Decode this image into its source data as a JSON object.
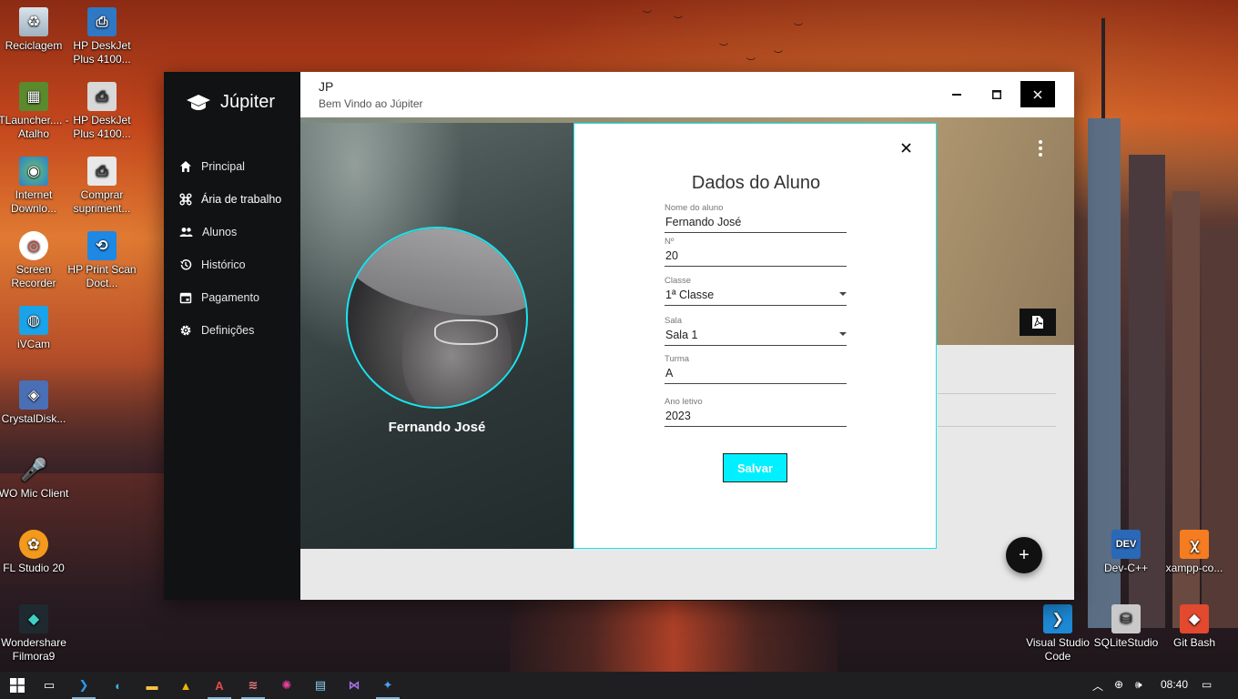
{
  "desktop": {
    "icons_left": [
      {
        "label": "Reciclagem"
      },
      {
        "label": "HP DeskJet Plus 4100..."
      },
      {
        "label": "TLauncher.... - Atalho"
      },
      {
        "label": "HP DeskJet Plus 4100..."
      },
      {
        "label": "Internet Downlo..."
      },
      {
        "label": "Comprar supriment..."
      },
      {
        "label": "Screen Recorder"
      },
      {
        "label": "HP Print Scan Doct..."
      },
      {
        "label": "iVCam"
      },
      {
        "label": "CrystalDisk..."
      },
      {
        "label": "WO Mic Client"
      },
      {
        "label": "FL Studio 20"
      },
      {
        "label": "Wondershare Filmora9"
      }
    ],
    "icons_right": [
      {
        "label": "Dev-C++"
      },
      {
        "label": "xampp-co..."
      },
      {
        "label": "Visual Studio Code"
      },
      {
        "label": "SQLiteStudio"
      },
      {
        "label": "Git Bash"
      }
    ]
  },
  "app": {
    "brand": "Júpiter",
    "nav": [
      {
        "label": "Principal",
        "icon": "home-icon"
      },
      {
        "label": "Ária de trabalho",
        "icon": "command-icon"
      },
      {
        "label": "Alunos",
        "icon": "people-icon"
      },
      {
        "label": "Histórico",
        "icon": "history-icon"
      },
      {
        "label": "Pagamento",
        "icon": "calendar-icon"
      },
      {
        "label": "Definições",
        "icon": "gear-icon"
      }
    ],
    "titlebar": {
      "title": "JP",
      "subtitle": "Bem Vindo ao  Júpiter"
    },
    "fab_label": "+"
  },
  "student": {
    "display_name": "Fernando José"
  },
  "form": {
    "title": "Dados do Aluno",
    "fields": {
      "nome": {
        "label": "Nome do aluno",
        "value": "Fernando José"
      },
      "numero": {
        "label": "Nº",
        "value": "20"
      },
      "classe": {
        "label": "Classe",
        "value": "1ª Classe"
      },
      "sala": {
        "label": "Sala",
        "value": "Sala 1"
      },
      "turma": {
        "label": "Turma",
        "value": "A"
      },
      "ano": {
        "label": "Ano letivo",
        "value": "2023"
      }
    },
    "save_label": "Salvar"
  },
  "taskbar": {
    "time": "08:40"
  },
  "colors": {
    "accent": "#00f0ff",
    "sidebar": "#111214"
  }
}
